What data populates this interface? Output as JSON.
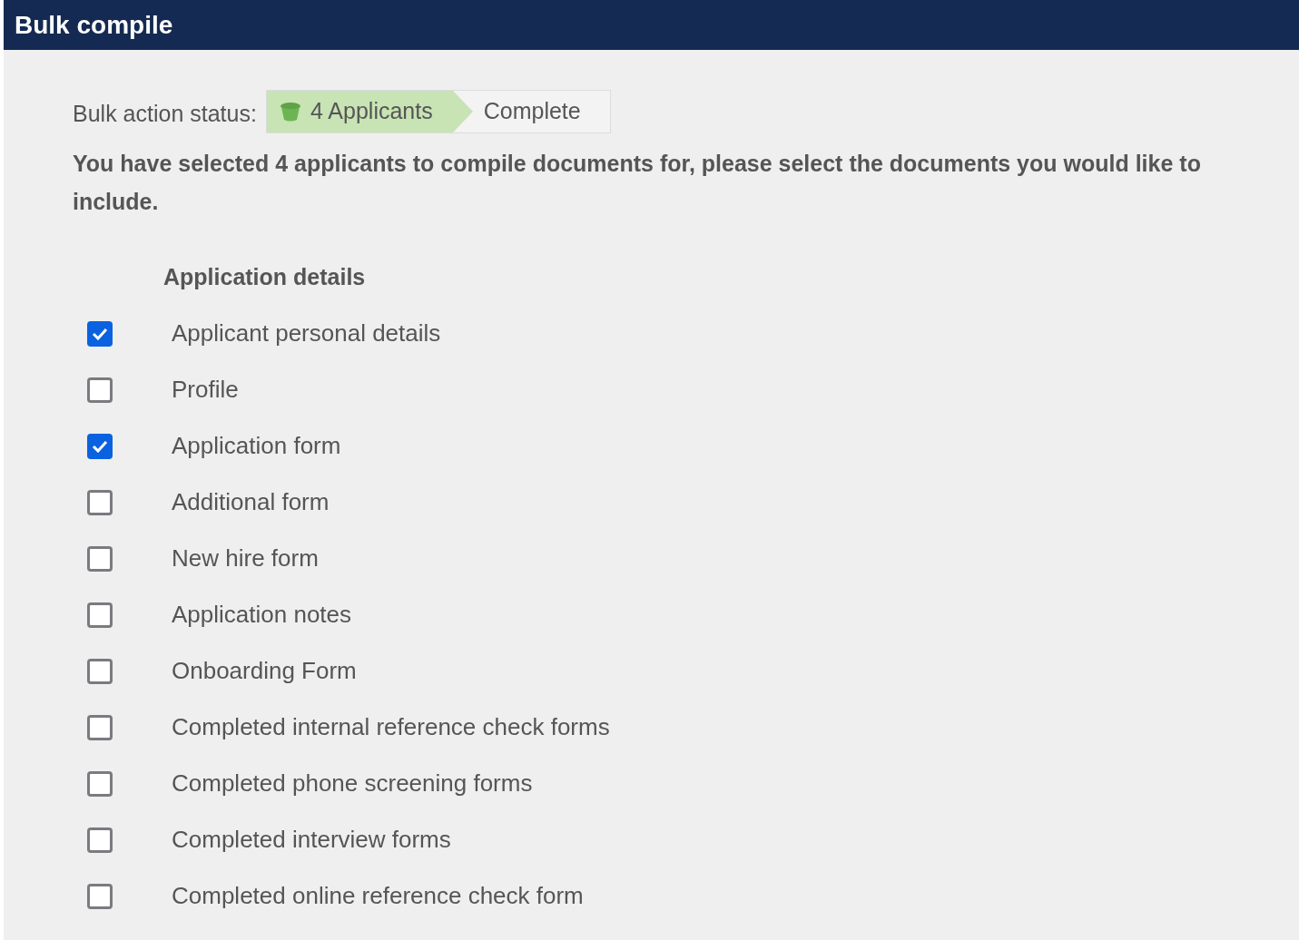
{
  "window": {
    "title": "Bulk compile"
  },
  "status": {
    "label": "Bulk action status:",
    "steps": [
      {
        "label": "4 Applicants",
        "complete": true
      },
      {
        "label": "Complete",
        "complete": false
      }
    ]
  },
  "instructions": "You have selected 4 applicants to compile documents for, please select the documents you would like to include.",
  "section": {
    "title": "Application details",
    "items": [
      {
        "label": "Applicant personal details",
        "checked": true
      },
      {
        "label": "Profile",
        "checked": false
      },
      {
        "label": "Application form",
        "checked": true
      },
      {
        "label": "Additional form",
        "checked": false
      },
      {
        "label": "New hire form",
        "checked": false
      },
      {
        "label": "Application notes",
        "checked": false
      },
      {
        "label": "Onboarding Form",
        "checked": false
      },
      {
        "label": "Completed internal reference check forms",
        "checked": false
      },
      {
        "label": "Completed phone screening forms",
        "checked": false
      },
      {
        "label": "Completed interview forms",
        "checked": false
      },
      {
        "label": "Completed online reference check form",
        "checked": false
      }
    ]
  }
}
